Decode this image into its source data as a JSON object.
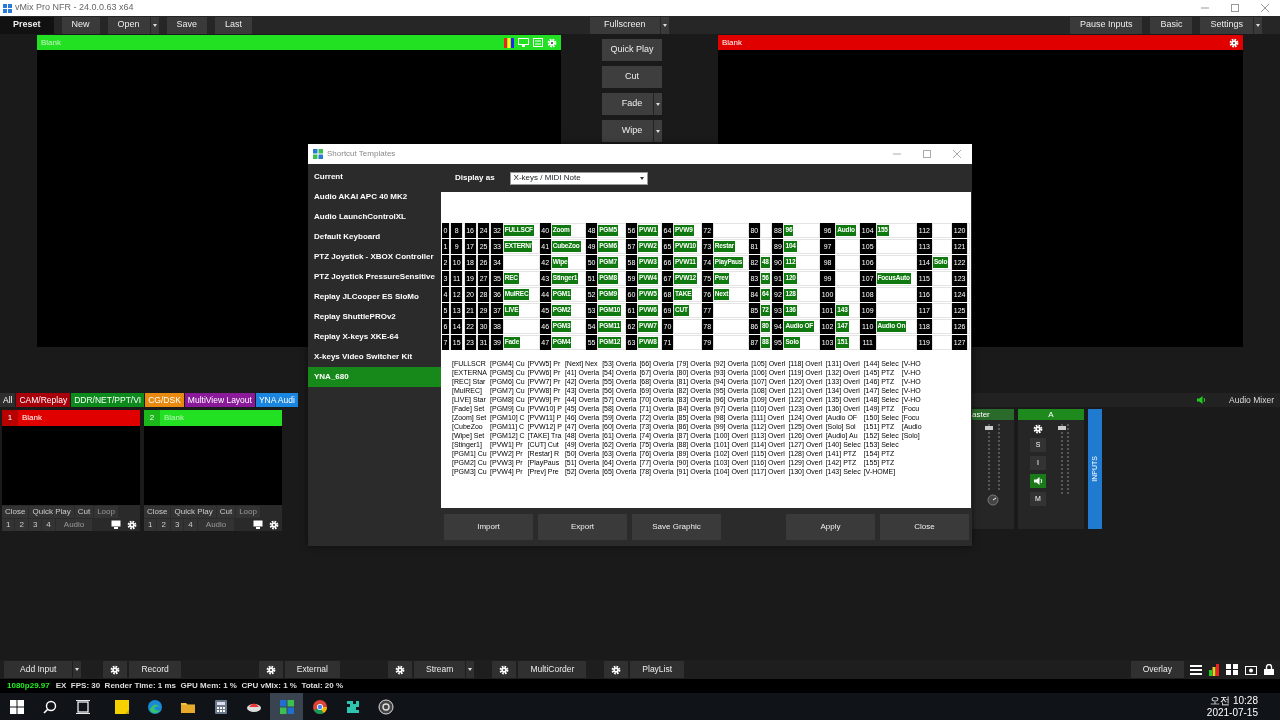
{
  "window": {
    "title": "vMix Pro NFR - 24.0.0.63 x64"
  },
  "toolbar": {
    "left": [
      {
        "label": "Preset",
        "selected": true,
        "dropdown": false
      },
      {
        "label": "New",
        "selected": false,
        "dropdown": false
      },
      {
        "label": "Open",
        "selected": false,
        "dropdown": true
      },
      {
        "label": "Save",
        "selected": false,
        "dropdown": false
      },
      {
        "label": "Last",
        "selected": false,
        "dropdown": false
      }
    ],
    "center": [
      {
        "label": "Fullscreen",
        "selected": false,
        "dropdown": true
      }
    ],
    "right": [
      {
        "label": "Pause Inputs",
        "selected": false,
        "dropdown": false
      },
      {
        "label": "Basic",
        "selected": false,
        "dropdown": false
      },
      {
        "label": "Settings",
        "selected": false,
        "dropdown": true
      }
    ]
  },
  "preview": {
    "title": "Blank",
    "color": "#22e022"
  },
  "output": {
    "title": "Blank",
    "color": "#e00000"
  },
  "transitions": [
    {
      "label": "Quick Play",
      "dropdown": false
    },
    {
      "label": "Cut",
      "dropdown": false
    },
    {
      "label": "Fade",
      "dropdown": true
    },
    {
      "label": "Wipe",
      "dropdown": true
    }
  ],
  "input_tabs": [
    {
      "label": "All",
      "color": "#2e2e2e"
    },
    {
      "label": "CAM/Replay",
      "color": "#a8000a"
    },
    {
      "label": "DDR/NET/PPT/VI",
      "color": "#0c8a1c"
    },
    {
      "label": "CG/DSK",
      "color": "#e88a10"
    },
    {
      "label": "MultiView Layout",
      "color": "#8a1a9a"
    },
    {
      "label": "YNA Audi",
      "color": "#1a86e0"
    }
  ],
  "inputs": [
    {
      "number": "1",
      "title": "Blank",
      "color": "#e00000",
      "controls": [
        "Close",
        "Quick Play",
        "Cut",
        "Loop"
      ],
      "overlays": [
        "1",
        "2",
        "3",
        "4"
      ],
      "audio": "Audio"
    },
    {
      "number": "2",
      "title": "Blank",
      "color": "#22e022",
      "controls": [
        "Close",
        "Quick Play",
        "Cut",
        "Loop"
      ],
      "overlays": [
        "1",
        "2",
        "3",
        "4"
      ],
      "audio": "Audio"
    }
  ],
  "mixer": {
    "title": "Audio Mixer",
    "strips": [
      {
        "name": "aster",
        "kind": "master"
      },
      {
        "name": "A",
        "kind": "bus",
        "buttons": [
          "S",
          "I",
          "M"
        ]
      }
    ],
    "side_tab": "INPUTS"
  },
  "dialog": {
    "title": "Shortcut Templates",
    "templates": [
      {
        "label": "Current",
        "selected": false
      },
      {
        "label": "Audio AKAI APC 40 MK2",
        "selected": false
      },
      {
        "label": "Audio LaunchControlXL",
        "selected": false
      },
      {
        "label": "Default Keyboard",
        "selected": false
      },
      {
        "label": "PTZ Joystick - XBOX Controller",
        "selected": false
      },
      {
        "label": "PTZ Joystick PressureSensitive",
        "selected": false
      },
      {
        "label": "Replay JLCooper ES SloMo",
        "selected": false
      },
      {
        "label": "Replay ShuttlePROv2",
        "selected": false
      },
      {
        "label": "Replay X-keys XKE-64",
        "selected": false
      },
      {
        "label": "X-keys Video Switcher Kit",
        "selected": false
      },
      {
        "label": "YNA_680",
        "selected": true
      }
    ],
    "display_as_label": "Display as",
    "display_as_value": "X-keys / MIDI Note",
    "grid": [
      {
        "cells": [
          {
            "n": "0"
          },
          {
            "n": "8"
          },
          {
            "n": "16"
          },
          {
            "n": "24"
          },
          {
            "n": "32",
            "label": "FULLSCF"
          },
          {
            "n": "40",
            "label": "Zoom"
          },
          {
            "n": "48",
            "label": "PGM5"
          },
          {
            "n": "56",
            "label": "PVW1"
          },
          {
            "n": "64",
            "label": "PVW9"
          },
          {
            "n": "72"
          },
          {
            "n": "80"
          },
          {
            "n": "88",
            "label": "96"
          },
          {
            "n": "96",
            "label": "Audio"
          },
          {
            "n": "104",
            "label": "155"
          },
          {
            "n": "112"
          },
          {
            "n": "120"
          }
        ]
      },
      {
        "cells": [
          {
            "n": "1"
          },
          {
            "n": "9"
          },
          {
            "n": "17"
          },
          {
            "n": "25"
          },
          {
            "n": "33",
            "label": "EXTERN/"
          },
          {
            "n": "41",
            "label": "CubeZoo"
          },
          {
            "n": "49",
            "label": "PGM6"
          },
          {
            "n": "57",
            "label": "PVW2"
          },
          {
            "n": "65",
            "label": "PVW10"
          },
          {
            "n": "73",
            "label": "Restar"
          },
          {
            "n": "81"
          },
          {
            "n": "89",
            "label": "104"
          },
          {
            "n": "97"
          },
          {
            "n": "105"
          },
          {
            "n": "113"
          },
          {
            "n": "121"
          }
        ]
      },
      {
        "cells": [
          {
            "n": "2"
          },
          {
            "n": "10"
          },
          {
            "n": "18"
          },
          {
            "n": "26"
          },
          {
            "n": "34"
          },
          {
            "n": "42",
            "label": "Wipe"
          },
          {
            "n": "50",
            "label": "PGM7"
          },
          {
            "n": "58",
            "label": "PVW3"
          },
          {
            "n": "66",
            "label": "PVW11"
          },
          {
            "n": "74",
            "label": "PlayPaus"
          },
          {
            "n": "82",
            "label": "48"
          },
          {
            "n": "90",
            "label": "112"
          },
          {
            "n": "98"
          },
          {
            "n": "106"
          },
          {
            "n": "114",
            "label": "Solo"
          },
          {
            "n": "122"
          }
        ]
      },
      {
        "cells": [
          {
            "n": "3"
          },
          {
            "n": "11"
          },
          {
            "n": "19"
          },
          {
            "n": "27"
          },
          {
            "n": "35",
            "label": "REC"
          },
          {
            "n": "43",
            "label": "Stinger1"
          },
          {
            "n": "51",
            "label": "PGM8"
          },
          {
            "n": "59",
            "label": "PVW4"
          },
          {
            "n": "67",
            "label": "PVW12"
          },
          {
            "n": "75",
            "label": "Prev"
          },
          {
            "n": "83",
            "label": "56"
          },
          {
            "n": "91",
            "label": "120"
          },
          {
            "n": "99"
          },
          {
            "n": "107",
            "label": "FocusAuto"
          },
          {
            "n": "115"
          },
          {
            "n": "123"
          }
        ]
      },
      {
        "cells": [
          {
            "n": "4"
          },
          {
            "n": "12"
          },
          {
            "n": "20"
          },
          {
            "n": "28"
          },
          {
            "n": "36",
            "label": "MulREC"
          },
          {
            "n": "44",
            "label": "PGM1"
          },
          {
            "n": "52",
            "label": "PGM9"
          },
          {
            "n": "60",
            "label": "PVW5"
          },
          {
            "n": "68",
            "label": "TAKE"
          },
          {
            "n": "76",
            "label": "Next"
          },
          {
            "n": "84",
            "label": "64"
          },
          {
            "n": "92",
            "label": "128"
          },
          {
            "n": "100"
          },
          {
            "n": "108"
          },
          {
            "n": "116"
          },
          {
            "n": "124"
          }
        ]
      },
      {
        "cells": [
          {
            "n": "5"
          },
          {
            "n": "13"
          },
          {
            "n": "21"
          },
          {
            "n": "29"
          },
          {
            "n": "37",
            "label": "LIVE"
          },
          {
            "n": "45",
            "label": "PGM2"
          },
          {
            "n": "53",
            "label": "PGM10"
          },
          {
            "n": "61",
            "label": "PVW6"
          },
          {
            "n": "69",
            "label": "CUT"
          },
          {
            "n": "77"
          },
          {
            "n": "85",
            "label": "72"
          },
          {
            "n": "93",
            "label": "136"
          },
          {
            "n": "101",
            "label": "143"
          },
          {
            "n": "109"
          },
          {
            "n": "117"
          },
          {
            "n": "125"
          }
        ]
      },
      {
        "cells": [
          {
            "n": "6"
          },
          {
            "n": "14"
          },
          {
            "n": "22"
          },
          {
            "n": "30"
          },
          {
            "n": "38"
          },
          {
            "n": "46",
            "label": "PGM3"
          },
          {
            "n": "54",
            "label": "PGM11"
          },
          {
            "n": "62",
            "label": "PVW7"
          },
          {
            "n": "70"
          },
          {
            "n": "78"
          },
          {
            "n": "86",
            "label": "80"
          },
          {
            "n": "94",
            "label": "Audio OF"
          },
          {
            "n": "102",
            "label": "147"
          },
          {
            "n": "110",
            "label": "Audio On"
          },
          {
            "n": "118"
          },
          {
            "n": "126"
          }
        ]
      },
      {
        "cells": [
          {
            "n": "7"
          },
          {
            "n": "15"
          },
          {
            "n": "23"
          },
          {
            "n": "31"
          },
          {
            "n": "39",
            "label": "Fade"
          },
          {
            "n": "47",
            "label": "PGM4"
          },
          {
            "n": "55",
            "label": "PGM12"
          },
          {
            "n": "63",
            "label": "PVW8"
          },
          {
            "n": "71"
          },
          {
            "n": "79"
          },
          {
            "n": "87",
            "label": "88"
          },
          {
            "n": "95",
            "label": "Solo"
          },
          {
            "n": "103",
            "label": "151"
          },
          {
            "n": "111"
          },
          {
            "n": "119"
          },
          {
            "n": "127"
          }
        ]
      }
    ],
    "legend": [
      [
        "[FULLSCR",
        "[EXTERNA",
        "[REC] Star",
        "[MulREC]",
        "[LIVE] Star",
        "[Fade] Set",
        "[Zoom] Set",
        "[CubeZoo",
        "[Wipe] Set",
        "[Stinger1]",
        "[PGM1] Cu",
        "[PGM2] Cu",
        "[PGM3] Cu"
      ],
      [
        "[PGM4] Cu",
        "[PGM5] Cu",
        "[PGM6] Cu",
        "[PGM7] Cu",
        "[PGM8] Cu",
        "[PGM9] Cu",
        "[PGM10] C",
        "[PGM11] C",
        "[PGM12] C",
        "[PVW1] Pr",
        "[PVW2] Pr",
        "[PVW3] Pr",
        "[PVW4] Pr"
      ],
      [
        "[PVW5] Pr",
        "[PVW6] Pr",
        "[PVW7] Pr",
        "[PVW8] Pr",
        "[PVW9] Pr",
        "[PVW10] P",
        "[PVW11] P",
        "[PVW12] P",
        "[TAKE] Tra",
        "[CUT] Cut",
        "[Restar] R",
        "[PlayPaus",
        "[Prev] Pre"
      ],
      [
        "[Next] Nex",
        "[41] Overla",
        "[42] Overla",
        "[43] Overla",
        "[44] Overla",
        "[45] Overla",
        "[46] Overla",
        "[47] Overla",
        "[48] Overla",
        "[49] Overla",
        "[50] Overla",
        "[51] Overla",
        "[52] Overla"
      ],
      [
        "[53] Overla",
        "[54] Overla",
        "[55] Overla",
        "[56] Overla",
        "[57] Overla",
        "[58] Overla",
        "[59] Overla",
        "[60] Overla",
        "[61] Overla",
        "[62] Overla",
        "[63] Overla",
        "[64] Overla",
        "[65] Overla"
      ],
      [
        "[66] Overla",
        "[67] Overla",
        "[68] Overla",
        "[69] Overla",
        "[70] Overla",
        "[71] Overla",
        "[72] Overla",
        "[73] Overla",
        "[74] Overla",
        "[75] Overla",
        "[76] Overla",
        "[77] Overla",
        "[78] Overla"
      ],
      [
        "[79] Overla",
        "[80] Overla",
        "[81] Overla",
        "[82] Overla",
        "[83] Overla",
        "[84] Overla",
        "[85] Overla",
        "[86] Overla",
        "[87] Overla",
        "[88] Overla",
        "[89] Overla",
        "[90] Overla",
        "[91] Overla"
      ],
      [
        "[92] Overla",
        "[93] Overla",
        "[94] Overla",
        "[95] Overla",
        "[96] Overla",
        "[97] Overla",
        "[98] Overla",
        "[99] Overla",
        "[100] Overl",
        "[101] Overl",
        "[102] Overl",
        "[103] Overl",
        "[104] Overl"
      ],
      [
        "[105] Overl",
        "[106] Overl",
        "[107] Overl",
        "[108] Overl",
        "[109] Overl",
        "[110] Overl",
        "[111] Overl",
        "[112] Overl",
        "[113] Overl",
        "[114] Overl",
        "[115] Overl",
        "[116] Overl",
        "[117] Overl"
      ],
      [
        "[118] Overl",
        "[119] Overl",
        "[120] Overl",
        "[121] Overl",
        "[122] Overl",
        "[123] Overl",
        "[124] Overl",
        "[125] Overl",
        "[126] Overl",
        "[127] Overl",
        "[128] Overl",
        "[129] Overl",
        "[130] Overl"
      ],
      [
        "[131] Overl",
        "[132] Overl",
        "[133] Overl",
        "[134] Overl",
        "[135] Overl",
        "[136] Overl",
        "[Audio OF",
        "[Solo] Sol",
        "[Audio] Au",
        "[140] Selec",
        "[141] PTZ",
        "[142] PTZ",
        "[143] Selec"
      ],
      [
        "[144] Selec",
        "[145] PTZ",
        "[146] PTZ",
        "[147] Selec",
        "[148] Selec",
        "[149] PTZ",
        "[150] Selec",
        "[151] PTZ",
        "[152] Selec",
        "[153] Selec",
        "[154] PTZ",
        "[155] PTZ",
        "[V-HOME]"
      ],
      [
        "[V-HO",
        "[V-HO",
        "[V-HO",
        "[V-HO",
        "[V-HO",
        "[Focu",
        "[Focu",
        "[Audio",
        "[Solo]"
      ]
    ],
    "buttons": [
      {
        "label": "Import"
      },
      {
        "label": "Export"
      },
      {
        "label": "Save Graphic"
      },
      {
        "label": "Apply"
      },
      {
        "label": "Close"
      }
    ]
  },
  "bottom_bar": [
    {
      "label": "Add Input",
      "kind": "split"
    },
    {
      "label": "Record",
      "kind": "gear"
    },
    {
      "label": "External",
      "kind": "gear"
    },
    {
      "label": "Stream",
      "kind": "gear_split"
    },
    {
      "label": "MultiCorder",
      "kind": "gear"
    },
    {
      "label": "PlayList",
      "kind": "gear"
    }
  ],
  "overlay_button": "Overlay",
  "status": {
    "format": "1080p29.97",
    "stats": "EX  FPS: 30  Render Time: 1 ms  GPU Mem: 1 %  CPU vMix: 1 %  Total: 20 %"
  },
  "taskbar": {
    "apps": [
      {
        "kind": "notes",
        "selected": false
      },
      {
        "kind": "edge",
        "selected": false
      },
      {
        "kind": "folder",
        "selected": false
      },
      {
        "kind": "calculator",
        "selected": false
      },
      {
        "kind": "bird",
        "selected": false
      },
      {
        "kind": "grid",
        "selected": true
      },
      {
        "kind": "chrome",
        "selected": false
      },
      {
        "kind": "puzzle",
        "selected": false
      },
      {
        "kind": "ring",
        "selected": false
      }
    ],
    "time": "오전 10:28",
    "date": "2021-07-15"
  }
}
